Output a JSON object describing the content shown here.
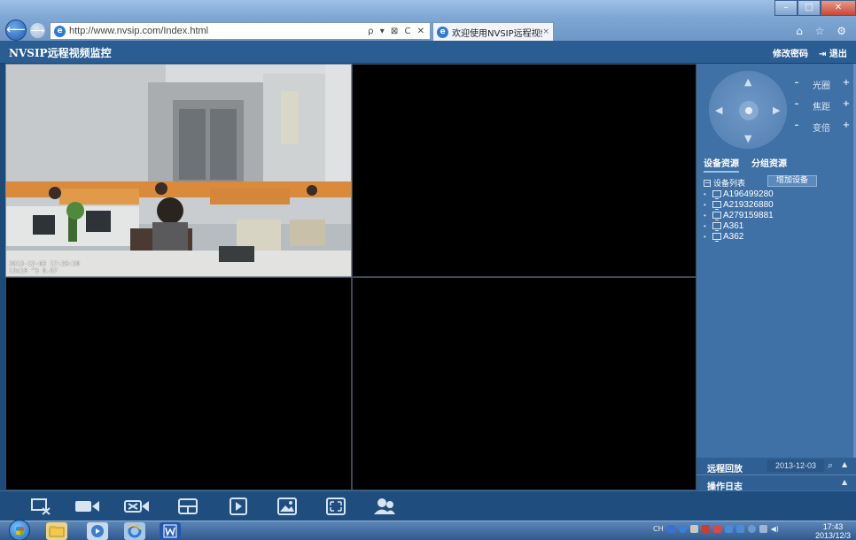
{
  "browser": {
    "url": "http://www.nvsip.com/Index.html",
    "tab_title": "欢迎使用NVSIP远程视频监...",
    "address_tools": "ρ ▾ ⊠ C ✕",
    "tab_close": "×",
    "minimize": "–",
    "maximize": "□",
    "close": "✕",
    "icons": "⌂ ☆ ⚙"
  },
  "app": {
    "title": "NVSIP远程视频监控",
    "change_password": "修改密码",
    "logout": "退出",
    "logout_icon": "⇥"
  },
  "video": {
    "timestamp_line1": "2013-12-03 17:29:20",
    "timestamp_line2": "13x18 ^3 0.67"
  },
  "ptz": {
    "iris_label": "光圈",
    "focus_label": "焦距",
    "zoom_label": "变倍",
    "minus": "–",
    "plus": "+"
  },
  "resources": {
    "tabs": [
      "设备资源",
      "分组资源"
    ],
    "device_list_label": "设备列表",
    "add_device_label": "增加设备",
    "devices": [
      "A196499280",
      "A219326880",
      "A279159881",
      "A361",
      "A362"
    ]
  },
  "bottom": {
    "playback_label": "远程回放",
    "playback_date": "2013-12-03",
    "log_label": "操作日志"
  },
  "taskbar": {
    "tray_lang": "CH",
    "time": "17:43",
    "date": "2013/12/3"
  },
  "colors": {
    "header": "#2a5d92",
    "panel": "#3f70a6",
    "toolbar": "#1f4d7e"
  }
}
